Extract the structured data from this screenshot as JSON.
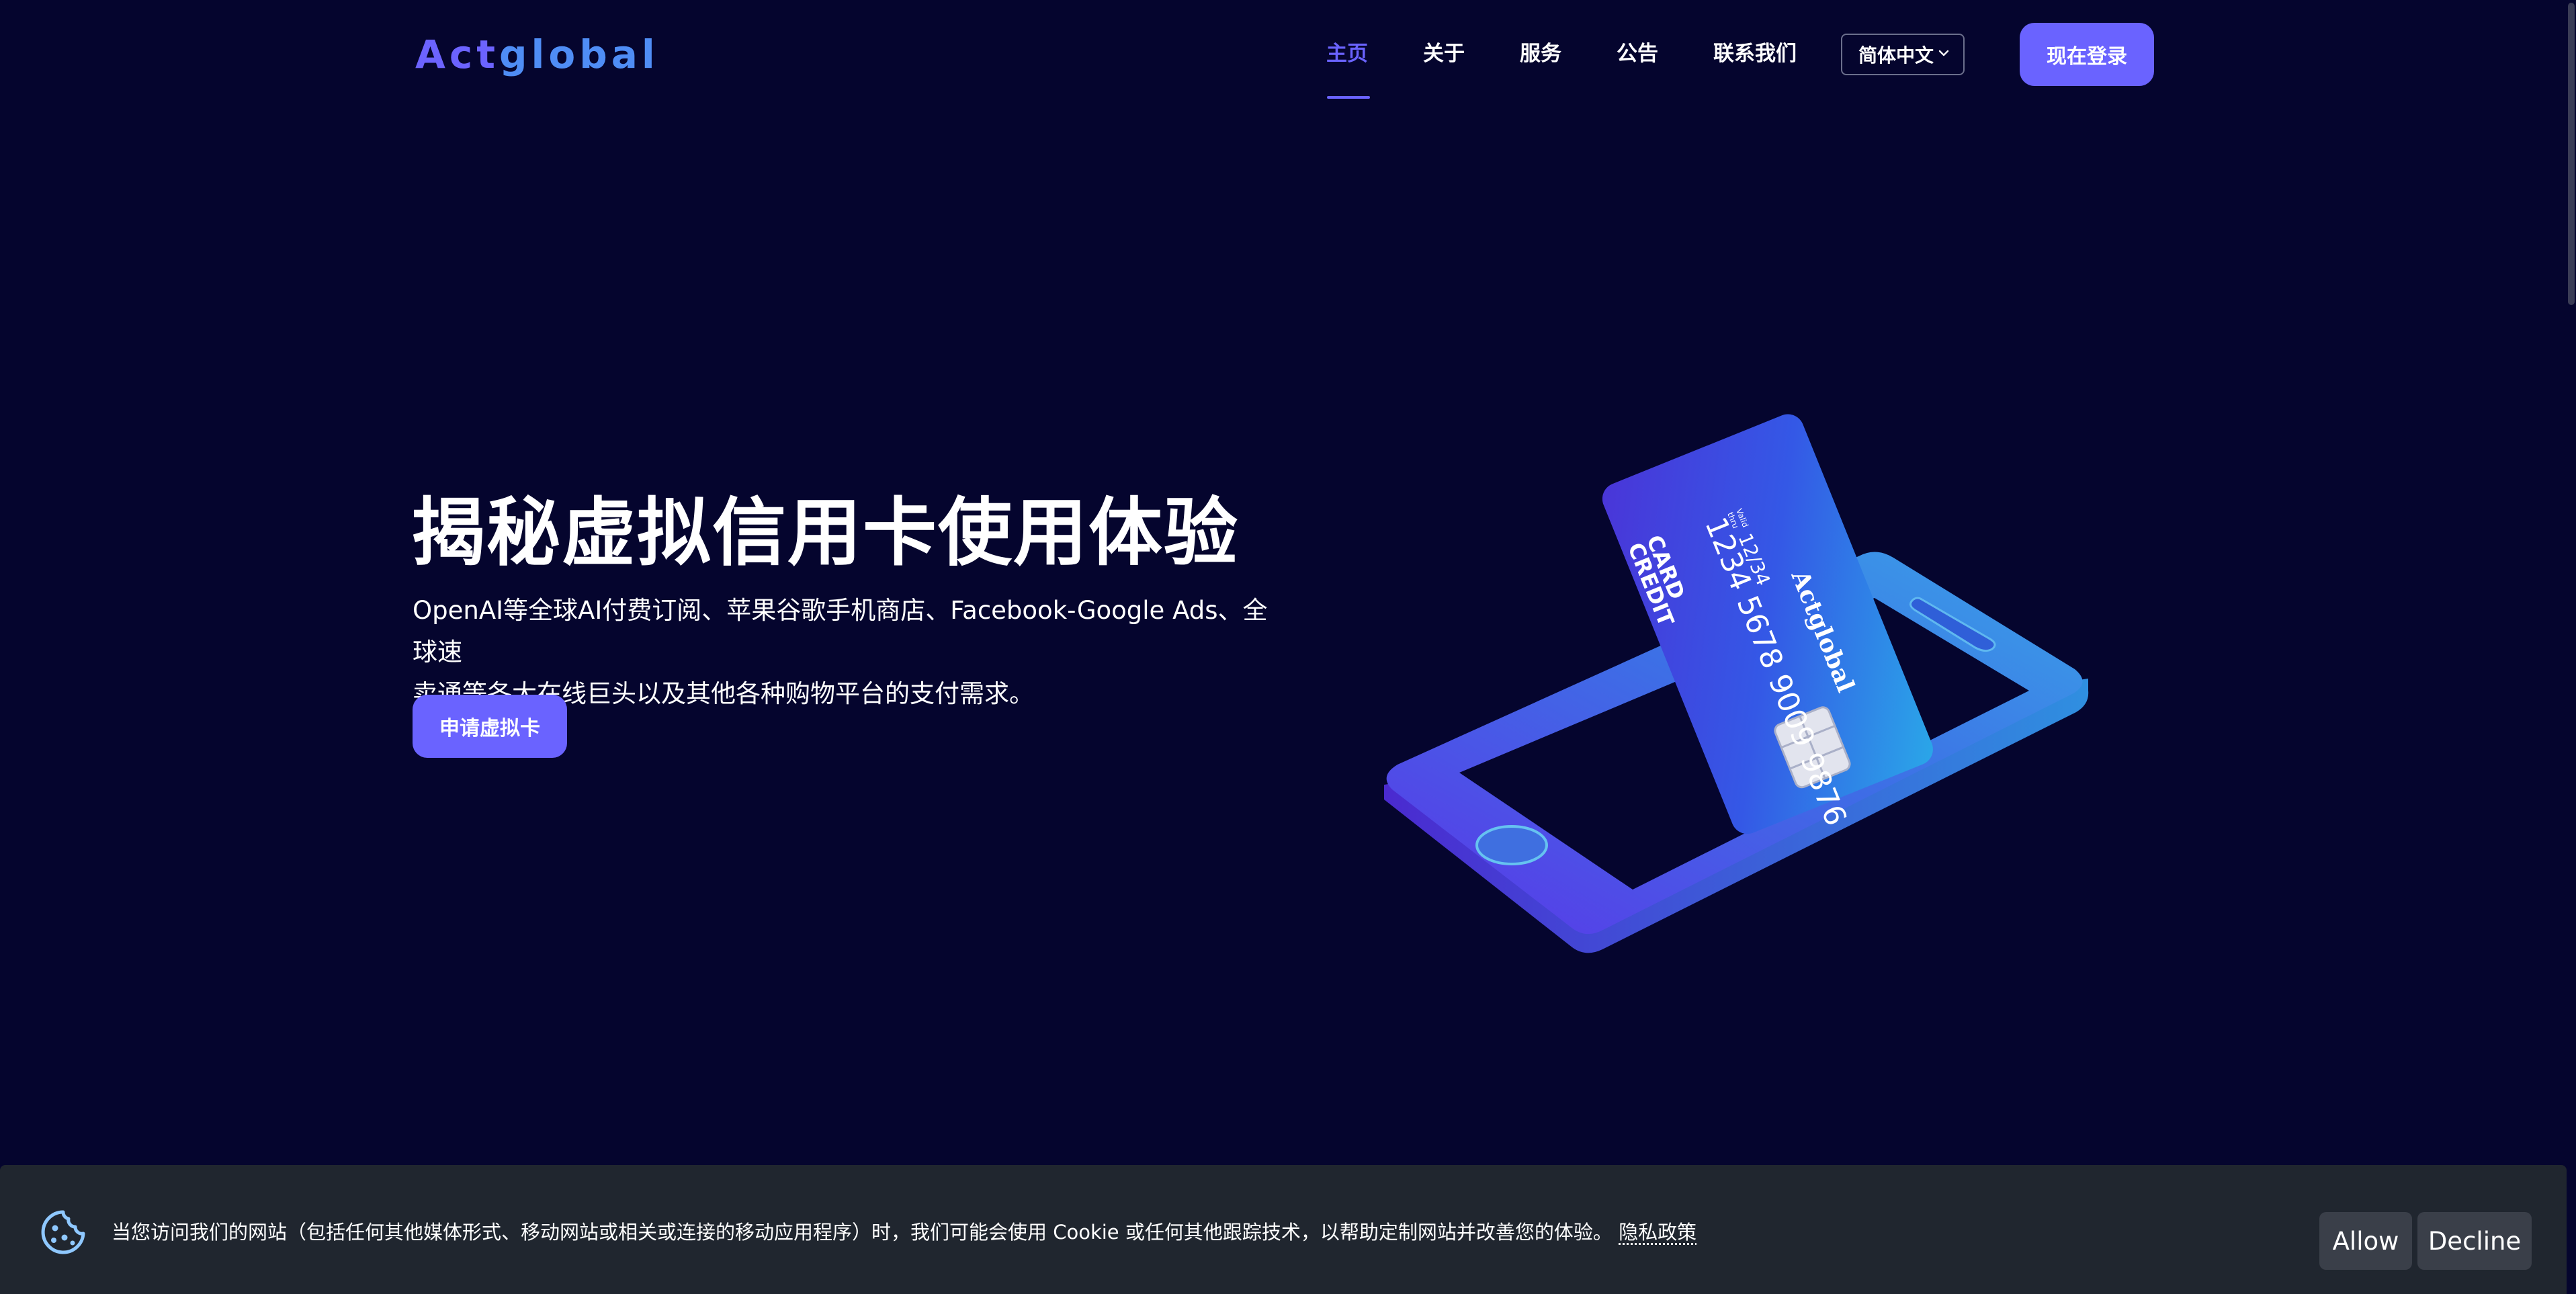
{
  "header": {
    "logo_part1": "Act",
    "logo_part2": "global",
    "nav": [
      "主页",
      "关于",
      "服务",
      "公告",
      "联系我们"
    ],
    "language": "简体中文",
    "login": "现在登录"
  },
  "hero": {
    "title": "揭秘虚拟信用卡使用体验",
    "description_line1": "OpenAI等全球AI付费订阅、苹果谷歌手机商店、Facebook-Google Ads、全球速",
    "description_line2": "卖通等各大在线巨头以及其他各种购物平台的支付需求。",
    "cta": "申请虚拟卡"
  },
  "illustration": {
    "card_title_line1": "CREDIT",
    "card_title_line2": "CARD",
    "card_number": "1234 5678 9009 9876",
    "card_expiry": "12/34",
    "card_expiry_label_line1": "Valid",
    "card_expiry_label_line2": "thru",
    "card_brand": "Actglobal"
  },
  "cookie": {
    "message": "当您访问我们的网站（包括任何其他媒体形式、移动网站或相关或连接的移动应用程序）时，我们可能会使用 Cookie 或任何其他跟踪技术，以帮助定制网站并改善您的体验。",
    "policy_link": "隐私政策",
    "allow": "Allow",
    "decline": "Decline"
  },
  "colors": {
    "background": "#05052e",
    "accent": "#6a63ff",
    "cookie_bar": "#20262f",
    "cookie_button": "#3a3f49"
  }
}
